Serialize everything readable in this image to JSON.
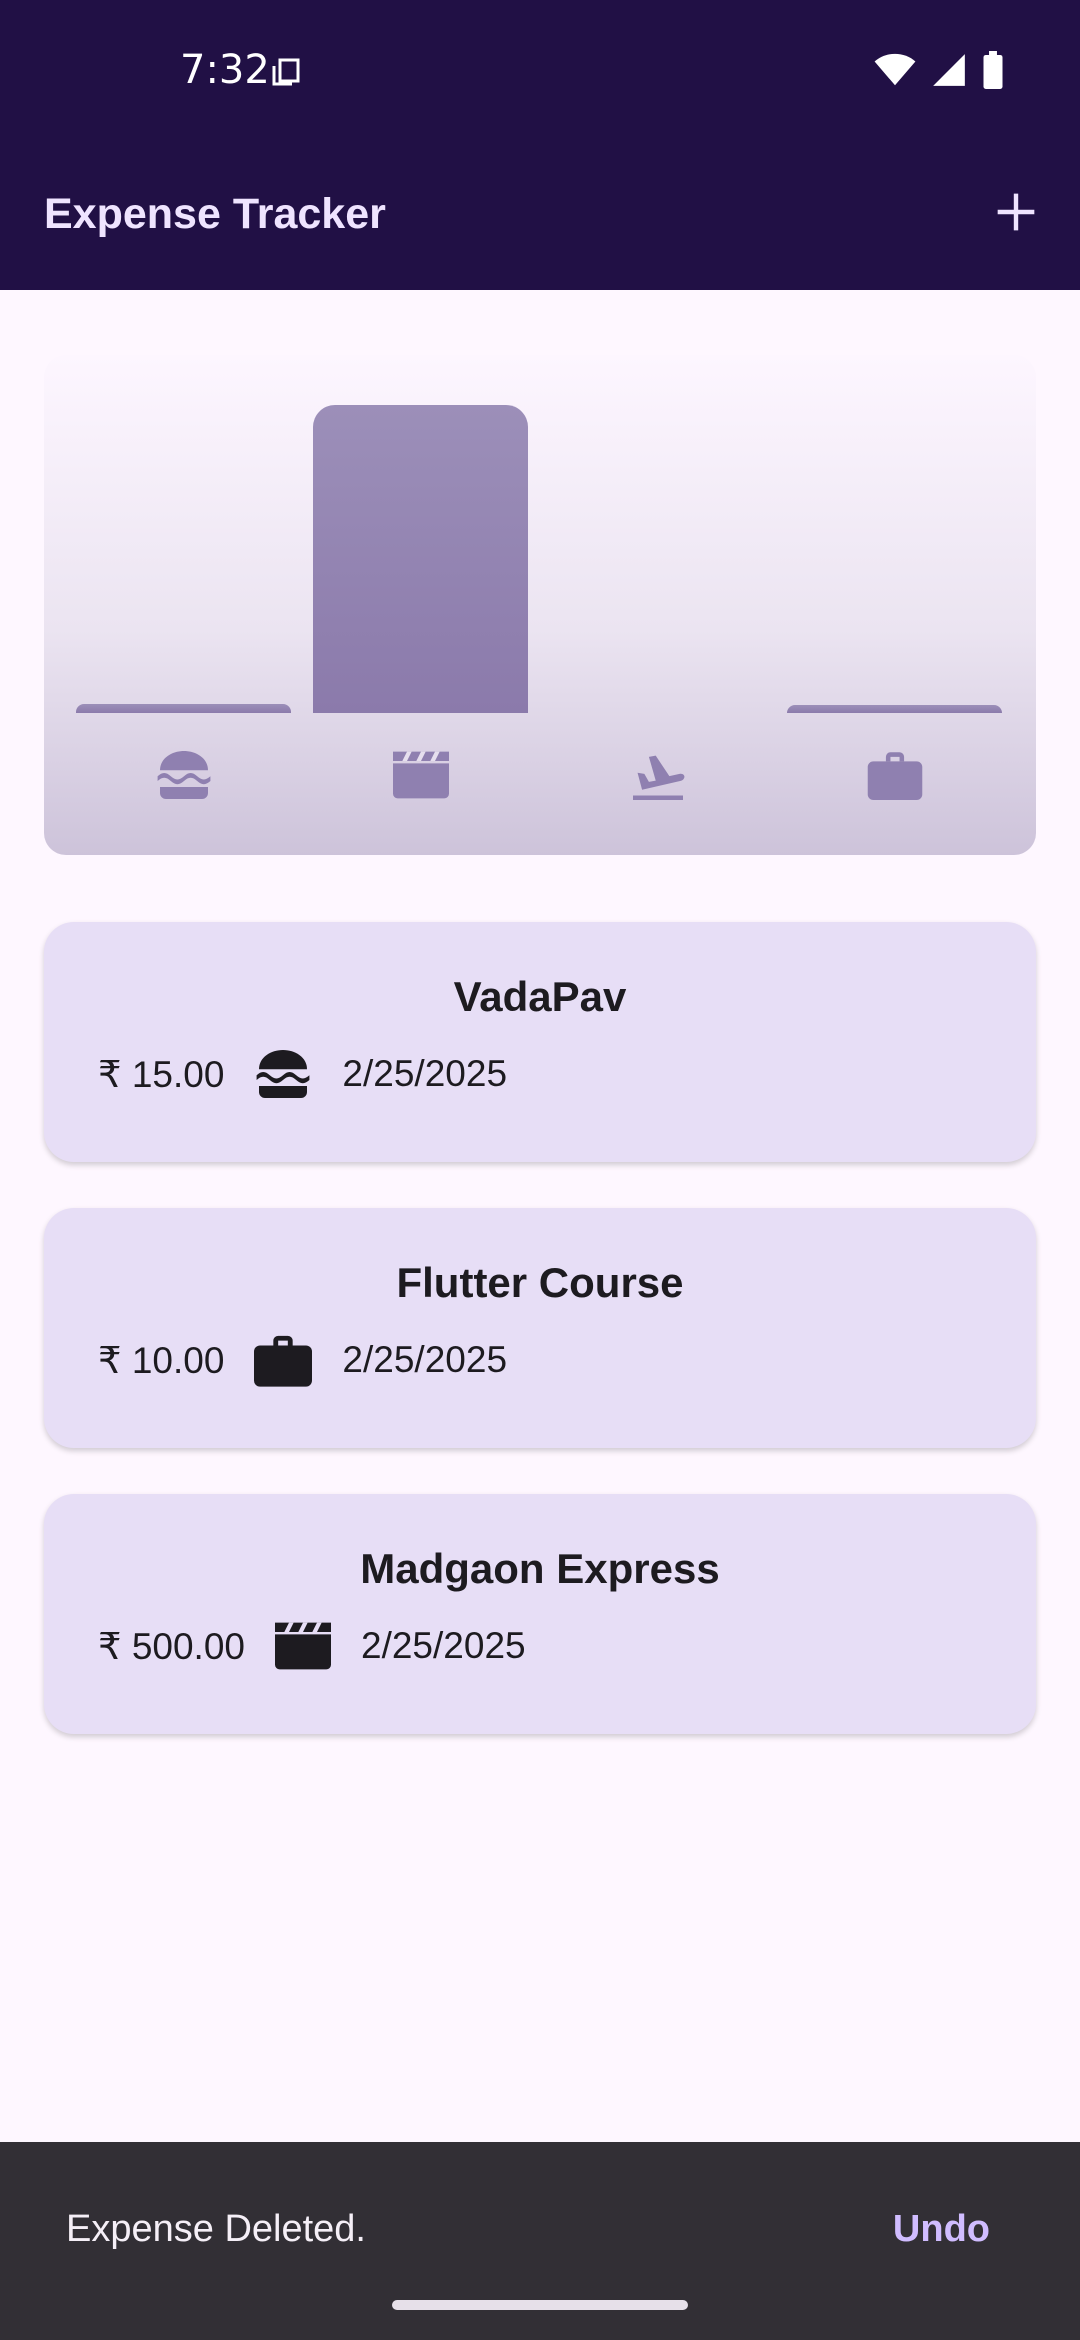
{
  "status_bar": {
    "time": "7:32",
    "icons": [
      "copy-icon",
      "wifi-icon",
      "signal-icon",
      "battery-icon"
    ]
  },
  "app_bar": {
    "title": "Expense Tracker",
    "action_icon": "add-icon"
  },
  "chart": {
    "categories": [
      "food-icon",
      "leisure-icon",
      "travel-icon",
      "work-icon"
    ],
    "bar_fractions": [
      0.03,
      1.0,
      0.0,
      0.02
    ]
  },
  "expenses": [
    {
      "title": "VadaPav",
      "amount": "₹ 15.00",
      "category_icon": "food-icon",
      "date": "2/25/2025"
    },
    {
      "title": "Flutter Course",
      "amount": "₹ 10.00",
      "category_icon": "work-icon",
      "date": "2/25/2025"
    },
    {
      "title": "Madgaon Express",
      "amount": "₹ 500.00",
      "category_icon": "leisure-icon",
      "date": "2/25/2025"
    }
  ],
  "snackbar": {
    "message": "Expense Deleted.",
    "action": "Undo"
  },
  "colors": {
    "app_bar_bg": "#211045",
    "card_bg": "#e7def6",
    "bar_color": "#8f80b0",
    "snackbar_bg": "#322f35",
    "snackbar_action": "#d0bcff"
  }
}
